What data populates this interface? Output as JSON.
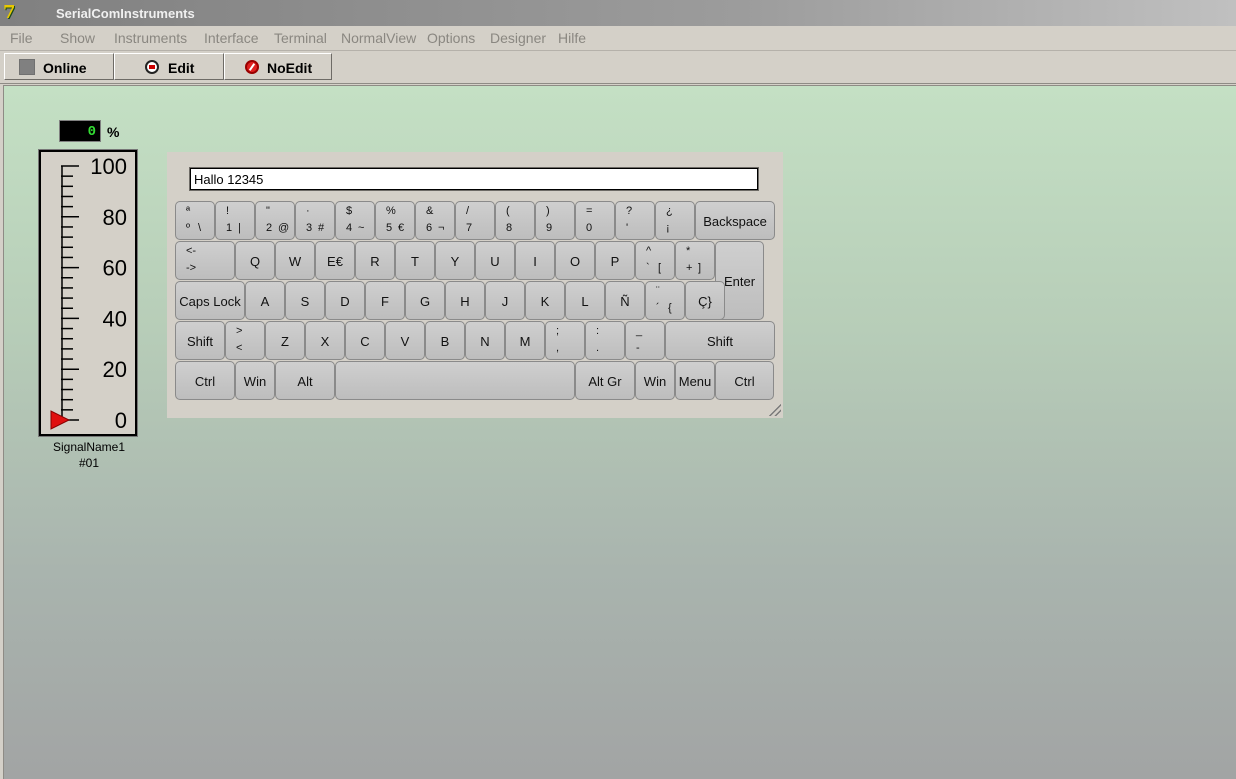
{
  "window": {
    "title": "SerialComInstruments"
  },
  "menu": [
    {
      "label": "File"
    },
    {
      "label": "Show"
    },
    {
      "label": "Instruments"
    },
    {
      "label": "Interface"
    },
    {
      "label": "Terminal"
    },
    {
      "label": "NormalView"
    },
    {
      "label": "Options"
    },
    {
      "label": "Designer"
    },
    {
      "label": "Hilfe"
    }
  ],
  "toolbar": {
    "online_label": "Online",
    "edit_label": "Edit",
    "noedit_label": "NoEdit"
  },
  "gauge": {
    "value": "0",
    "unit": "%",
    "scale": [
      "100",
      "80",
      "60",
      "40",
      "20",
      "0"
    ],
    "level": 0,
    "tag_name": "SignalName1",
    "tag_id": "#01",
    "accent": "#e01010"
  },
  "keyboard": {
    "input_value": "Hallo 12345",
    "rows": [
      [
        {
          "tl": "ª",
          "bl": "º",
          "br": "\\"
        },
        {
          "tl": "!",
          "bl": "1",
          "br": "|"
        },
        {
          "tl": "\"",
          "bl": "2",
          "br": "@"
        },
        {
          "tl": "·",
          "bl": "3",
          "br": "#"
        },
        {
          "tl": "$",
          "bl": "4",
          "br": "~"
        },
        {
          "tl": "%",
          "bl": "5",
          "br": "€"
        },
        {
          "tl": "&",
          "bl": "6",
          "br": "¬"
        },
        {
          "tl": "/",
          "bl": "7",
          "br": ""
        },
        {
          "tl": "(",
          "bl": "8",
          "br": ""
        },
        {
          "tl": ")",
          "bl": "9",
          "br": ""
        },
        {
          "tl": "=",
          "bl": "0",
          "br": ""
        },
        {
          "tl": "?",
          "bl": "'",
          "br": ""
        },
        {
          "tl": "¿",
          "bl": "¡",
          "br": ""
        },
        {
          "main": "Backspace"
        }
      ],
      [
        {
          "tl": "<-",
          "bl": "->",
          "br": ""
        },
        {
          "main": "Q"
        },
        {
          "main": "W"
        },
        {
          "main": "E€"
        },
        {
          "main": "R"
        },
        {
          "main": "T"
        },
        {
          "main": "Y"
        },
        {
          "main": "U"
        },
        {
          "main": "I"
        },
        {
          "main": "O"
        },
        {
          "main": "P"
        },
        {
          "tl": "^",
          "bl": "`",
          "br": "["
        },
        {
          "tl": "*",
          "bl": "+",
          "br": "]"
        },
        {
          "main": "Enter"
        }
      ],
      [
        {
          "main": "Caps Lock"
        },
        {
          "main": "A"
        },
        {
          "main": "S"
        },
        {
          "main": "D"
        },
        {
          "main": "F"
        },
        {
          "main": "G"
        },
        {
          "main": "H"
        },
        {
          "main": "J"
        },
        {
          "main": "K"
        },
        {
          "main": "L"
        },
        {
          "main": "Ñ"
        },
        {
          "tl": "¨",
          "bl": "´",
          "br": "{"
        },
        {
          "main": "Ç}"
        }
      ],
      [
        {
          "main": "Shift"
        },
        {
          "tl": ">",
          "bl": "<",
          "br": ""
        },
        {
          "main": "Z"
        },
        {
          "main": "X"
        },
        {
          "main": "C"
        },
        {
          "main": "V"
        },
        {
          "main": "B"
        },
        {
          "main": "N"
        },
        {
          "main": "M"
        },
        {
          "tl": ";",
          "bl": ",",
          "br": ""
        },
        {
          "tl": ":",
          "bl": ".",
          "br": ""
        },
        {
          "tl": "_",
          "bl": "-",
          "br": ""
        },
        {
          "main": "Shift"
        }
      ],
      [
        {
          "main": "Ctrl"
        },
        {
          "main": "Win"
        },
        {
          "main": "Alt"
        },
        {
          "main": ""
        },
        {
          "main": "Alt Gr"
        },
        {
          "main": "Win"
        },
        {
          "main": "Menu"
        },
        {
          "main": "Ctrl"
        }
      ]
    ]
  }
}
